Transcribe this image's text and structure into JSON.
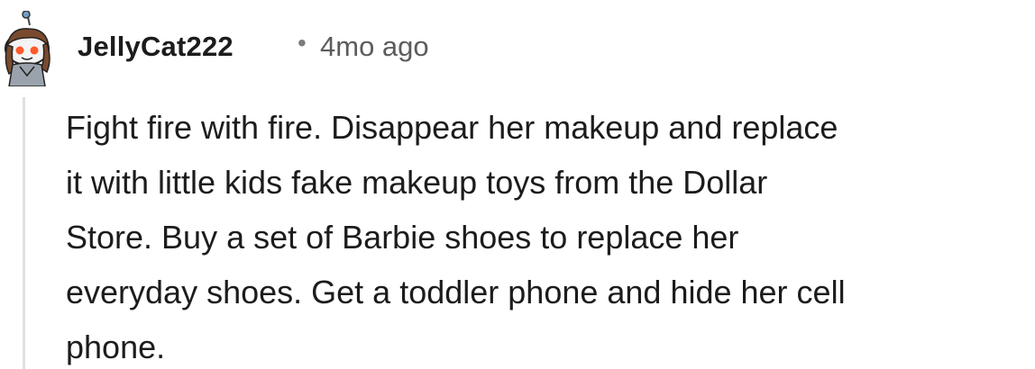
{
  "comment": {
    "username": "JellyCat222",
    "separator": "•",
    "timestamp": "4mo ago",
    "avatar_icon": "snoo-avatar-icon",
    "body_lines": [
      "Fight fire with fire. Disappear her makeup and replace",
      "it with little kids fake makeup toys from the Dollar",
      "Store. Buy a set of Barbie shoes to replace her",
      "everyday shoes. Get a toddler phone and hide her cell",
      "phone."
    ]
  },
  "colors": {
    "text": "#1c1c1c",
    "meta": "#5c5c5c",
    "thread_line": "#e0e0e0",
    "avatar_hair": "#7a4a2e",
    "avatar_bg": "#e9e9e9"
  }
}
